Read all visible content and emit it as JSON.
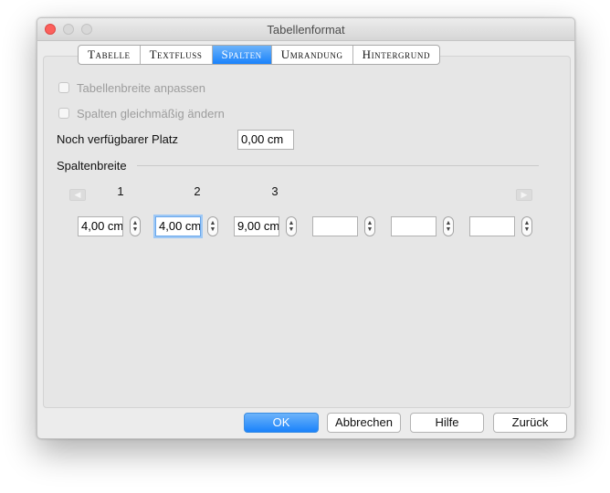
{
  "window": {
    "title": "Tabellenformat"
  },
  "tabs": [
    {
      "label": "Tabelle",
      "active": false
    },
    {
      "label": "Textfluss",
      "active": false
    },
    {
      "label": "Spalten",
      "active": true
    },
    {
      "label": "Umrandung",
      "active": false
    },
    {
      "label": "Hintergrund",
      "active": false
    }
  ],
  "options": {
    "adapt_table_width": {
      "label": "Tabellenbreite anpassen",
      "checked": false,
      "enabled": false
    },
    "even_columns": {
      "label": "Spalten gleichmäßig ändern",
      "checked": false,
      "enabled": false
    }
  },
  "remaining_space": {
    "label": "Noch verfügbarer Platz",
    "value": "0,00 cm"
  },
  "column_width": {
    "section_label": "Spaltenbreite",
    "left_arrow_icon": "arrow-left-icon",
    "right_arrow_icon": "arrow-right-icon",
    "column_numbers": [
      "1",
      "2",
      "3"
    ],
    "fields": [
      "4,00 cm",
      "4,00 cm",
      "9,00 cm",
      "",
      "",
      ""
    ]
  },
  "buttons": {
    "ok": "OK",
    "cancel": "Abbrechen",
    "help": "Hilfe",
    "reset": "Zurück"
  },
  "colors": {
    "accent": "#1a82fb",
    "close": "#fc605c"
  }
}
